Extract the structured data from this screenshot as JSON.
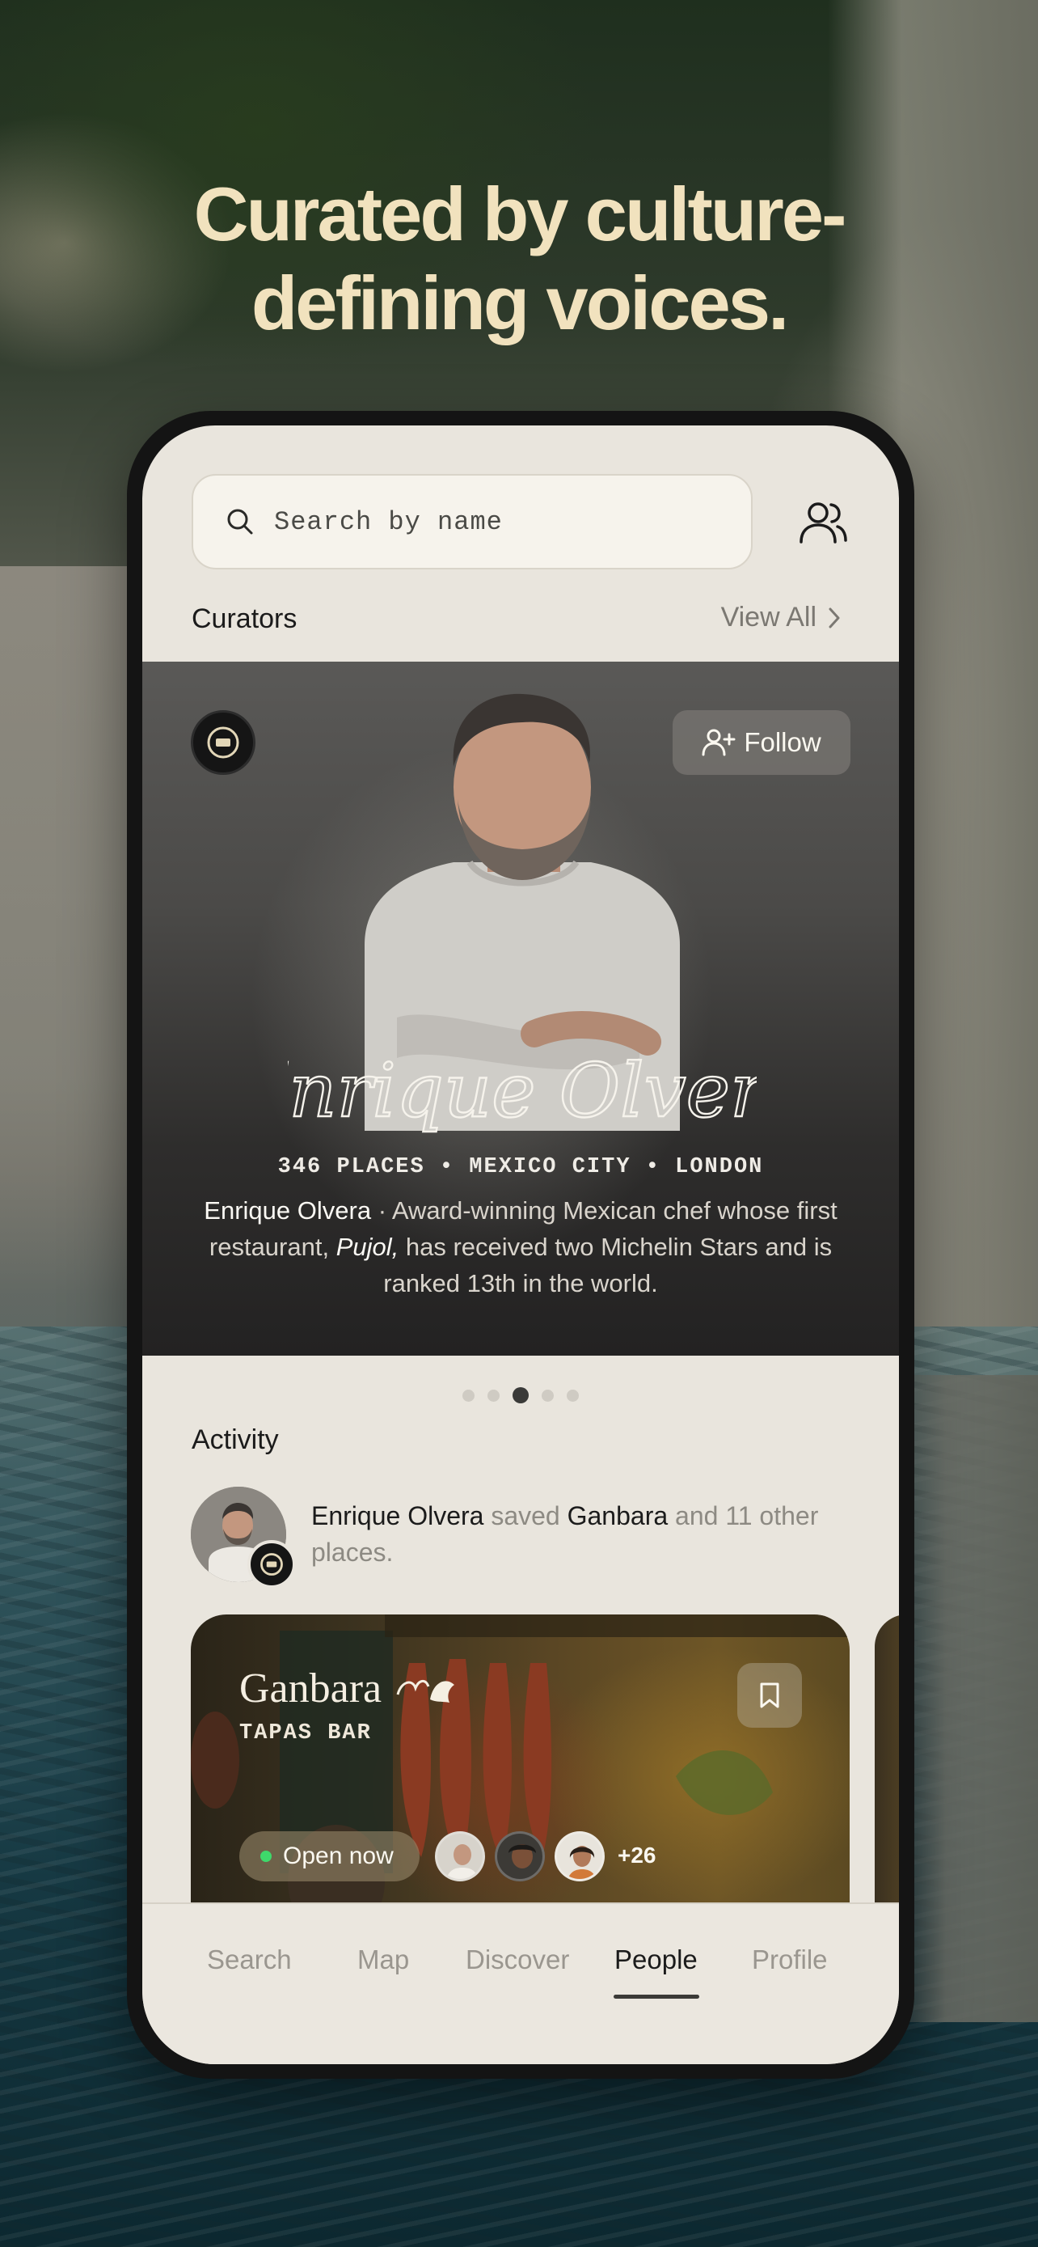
{
  "headline": "Curated by culture-defining voices.",
  "headline_lines": [
    "Curated by culture-",
    "defining voices."
  ],
  "search": {
    "placeholder": "Search by name"
  },
  "curators": {
    "title": "Curators",
    "view_all": "View All"
  },
  "hero": {
    "follow_label": "Follow",
    "name": "Enrique Olvera",
    "meta": "346 PLACES • MEXICO CITY • LONDON",
    "desc_name": "Enrique Olvera",
    "desc_part1": " · Award-winning Mexican chef whose first restaurant, ",
    "desc_italic": "Pujol,",
    "desc_part2": " has received two Michelin Stars and is ranked 13th in the world."
  },
  "carousel": {
    "count": 5,
    "active_index": 2
  },
  "activity": {
    "title": "Activity",
    "actor": "Enrique Olvera",
    "verb": " saved ",
    "place": "Ganbara",
    "rest": " and 11 other places."
  },
  "place_card": {
    "name": "Ganbara",
    "type": "TAPAS BAR",
    "status": "Open now",
    "status_color": "#3ed96b",
    "more_count": "+26"
  },
  "tabs": [
    {
      "label": "Search",
      "active": false
    },
    {
      "label": "Map",
      "active": false
    },
    {
      "label": "Discover",
      "active": false
    },
    {
      "label": "People",
      "active": true
    },
    {
      "label": "Profile",
      "active": false
    }
  ],
  "colors": {
    "headline": "#f1e2be",
    "screen_bg": "#e9e5dd",
    "accent_dark": "#1b1b1b"
  },
  "icons": [
    "search-icon",
    "people-icon",
    "chevron-right-icon",
    "user-plus-icon",
    "bookmark-icon",
    "curator-logo-icon",
    "dragon-icon"
  ]
}
